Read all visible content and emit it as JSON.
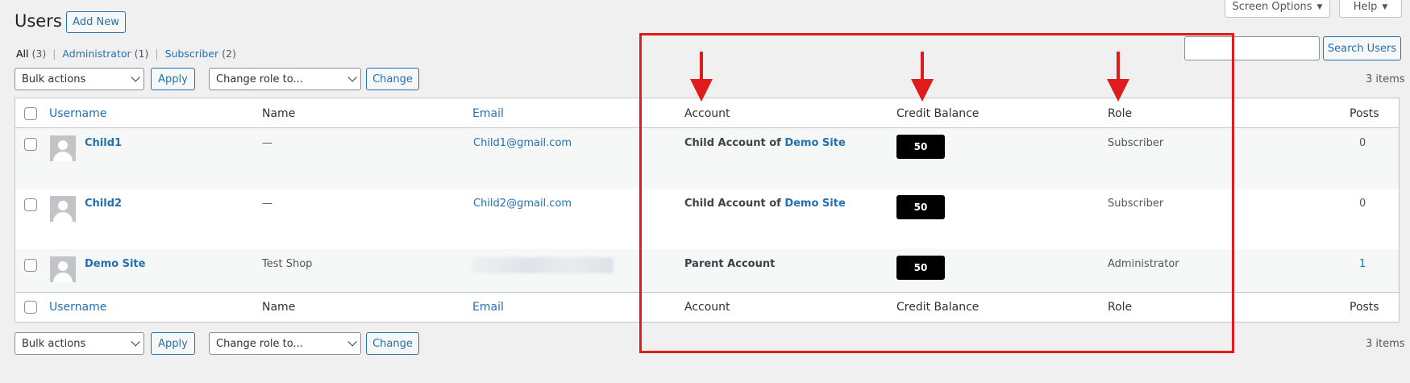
{
  "header": {
    "title": "Users",
    "add_new_label": "Add New",
    "screen_options_label": "Screen Options",
    "help_label": "Help"
  },
  "views": {
    "all_label": "All",
    "all_count": "(3)",
    "administrator_label": "Administrator",
    "administrator_count": "(1)",
    "subscriber_label": "Subscriber",
    "subscriber_count": "(2)",
    "separator": "|"
  },
  "search": {
    "value": "",
    "button_label": "Search Users"
  },
  "tablenav": {
    "bulk_actions": "Bulk actions",
    "apply_label": "Apply",
    "change_role": "Change role to...",
    "change_label": "Change",
    "items_count": "3 items"
  },
  "table": {
    "columns": {
      "username": "Username",
      "name": "Name",
      "email": "Email",
      "account": "Account",
      "credit_balance": "Credit Balance",
      "role": "Role",
      "posts": "Posts"
    },
    "rows": [
      {
        "username": "Child1",
        "name": "—",
        "email": "Child1@gmail.com",
        "account_prefix": "Child Account of",
        "account_link": "Demo Site",
        "credit": "50",
        "role": "Subscriber",
        "posts": "0"
      },
      {
        "username": "Child2",
        "name": "—",
        "email": "Child2@gmail.com",
        "account_prefix": "Child Account of",
        "account_link": "Demo Site",
        "credit": "50",
        "role": "Subscriber",
        "posts": "0"
      },
      {
        "username": "Demo Site",
        "name": "Test Shop",
        "email": "",
        "account_prefix": "Parent Account",
        "account_link": "",
        "credit": "50",
        "role": "Administrator",
        "posts": "1"
      }
    ]
  },
  "colors": {
    "link": "#2271b1",
    "annotation": "#e01b1b",
    "badge_bg": "#000000",
    "page_bg": "#f0f0f1"
  }
}
